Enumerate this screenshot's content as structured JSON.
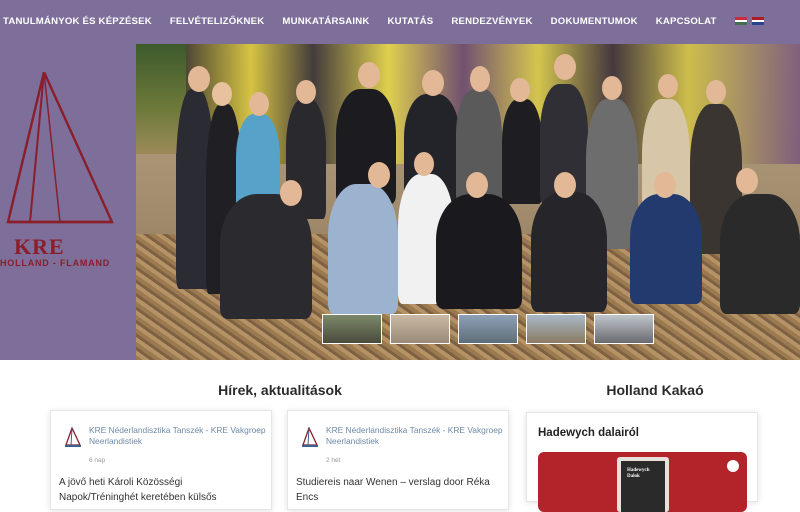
{
  "nav": {
    "items": [
      "TANULMÁNYOK ÉS KÉPZÉSEK",
      "FELVÉTELIZŐKNEK",
      "MUNKATÁRSAINK",
      "KUTATÁS",
      "RENDEZVÉNYEK",
      "DOKUMENTUMOK",
      "KAPCSOLAT"
    ],
    "flags": [
      {
        "name": "hungarian-flag-icon",
        "colors": [
          "#cd2a3e",
          "#ffffff",
          "#436f4d"
        ]
      },
      {
        "name": "dutch-flag-icon",
        "colors": [
          "#ae1c28",
          "#ffffff",
          "#21468b"
        ]
      }
    ]
  },
  "logo": {
    "title": "KRE",
    "subtitle": "HOLLAND - FLAMAND"
  },
  "colors": {
    "brand_purple": "#7d6e9a",
    "logo_red": "#8a1f2b",
    "link_blue": "#6d8aa8",
    "spotify_red": "#b2232a"
  },
  "news": {
    "title": "Hírek, aktualitások",
    "cards": [
      {
        "author": "KRE Néderlandisztika Tanszék - KRE Vakgroep Neerlandistiek",
        "time": "6 nap",
        "text": "A jövő heti Károli Közösségi Napok/Tréninghét keretében külsős"
      },
      {
        "author": "KRE Néderlandisztika Tanszék - KRE Vakgroep Neerlandistiek",
        "time": "2 hét",
        "text": "Studiereis naar Wenen – verslag door Réka Encs"
      }
    ]
  },
  "kakao": {
    "title": "Holland Kakaó",
    "card_title": "Hadewych dalairól",
    "album_label": "Hadewych Dalok"
  }
}
